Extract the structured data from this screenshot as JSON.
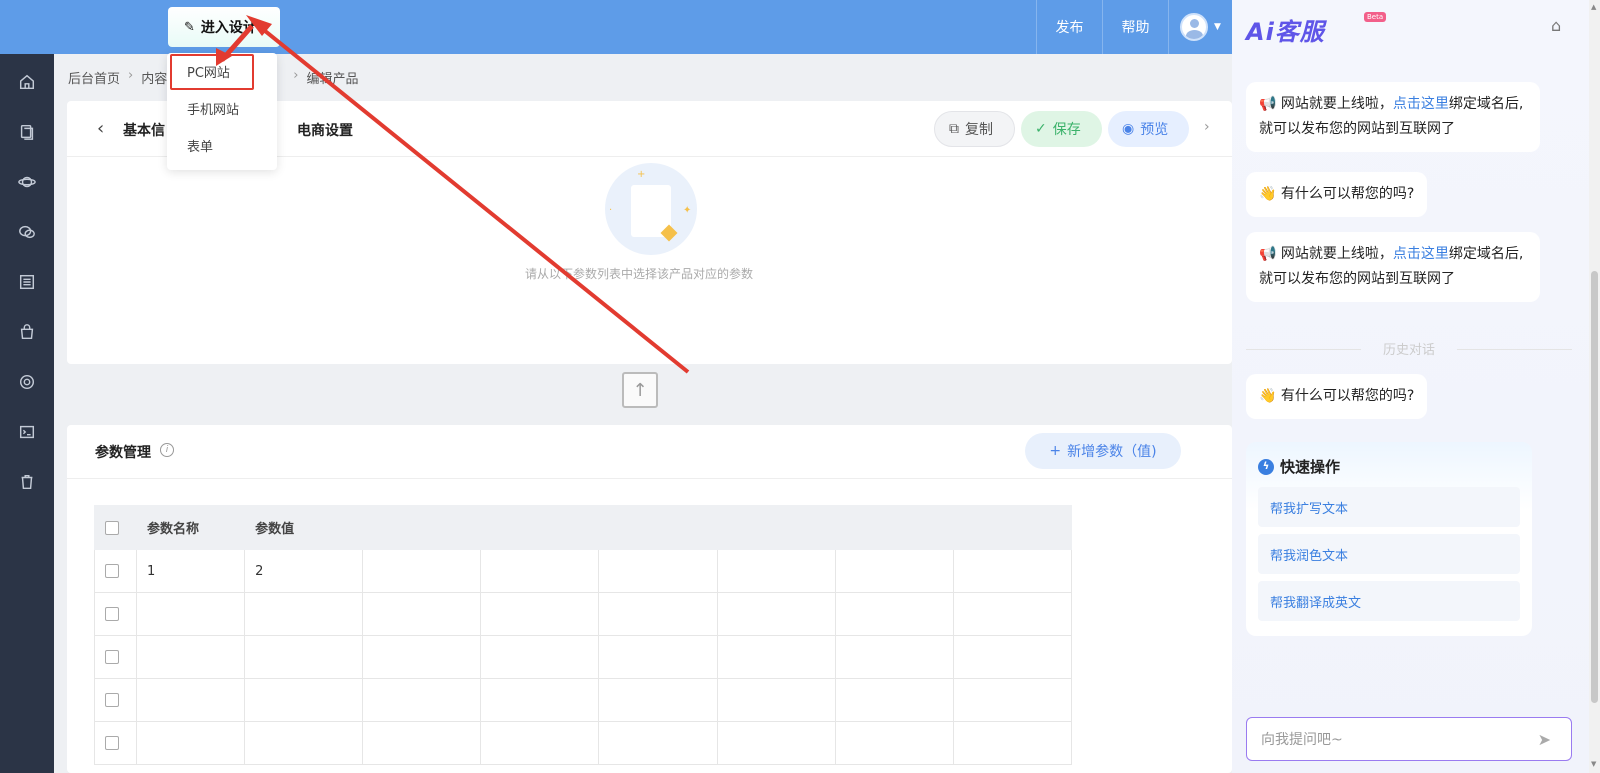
{
  "topbar": {
    "design_button": "进入设计",
    "publish": "发布",
    "help": "帮助"
  },
  "dropdown": {
    "items": [
      "PC网站",
      "手机网站",
      "表单"
    ]
  },
  "breadcrumb": {
    "home": "后台首页",
    "content": "内容",
    "current": "编辑产品"
  },
  "editor": {
    "tab_basic": "基本信",
    "tab_ecommerce": "电商设置",
    "copy": "复制",
    "save": "保存",
    "preview": "预览",
    "empty_text": "请从以下参数列表中选择该产品对应的参数"
  },
  "params": {
    "title": "参数管理",
    "add_button": "新增参数（值)",
    "columns": [
      "参数名称",
      "参数值"
    ],
    "rows": [
      {
        "name": "1",
        "value": "2"
      },
      {
        "name": "",
        "value": ""
      },
      {
        "name": "",
        "value": ""
      },
      {
        "name": "",
        "value": ""
      },
      {
        "name": "",
        "value": ""
      }
    ]
  },
  "ai": {
    "logo": "Ai客服",
    "beta": "Beta",
    "msg1_pre": "网站就要上线啦，",
    "msg1_link": "点击这里",
    "msg1_post": "绑定域名后,就可以发布您的网站到互联网了",
    "msg2": "有什么可以帮您的吗?",
    "msg3_pre": "网站就要上线啦，",
    "msg3_link": "点击这里",
    "msg3_post": "绑定域名后,就可以发布您的网站到互联网了",
    "history": "历史对话",
    "msg4": "有什么可以帮您的吗?",
    "quick_title": "快速操作",
    "quick_items": [
      "帮我扩写文本",
      "帮我润色文本",
      "帮我翻译成英文"
    ],
    "input_placeholder": "向我提问吧~"
  },
  "colors": {
    "topbar": "#5e9ce8",
    "sidebar": "#2b3446",
    "annotation": "#e23b30",
    "accent": "#3a7fe0"
  }
}
